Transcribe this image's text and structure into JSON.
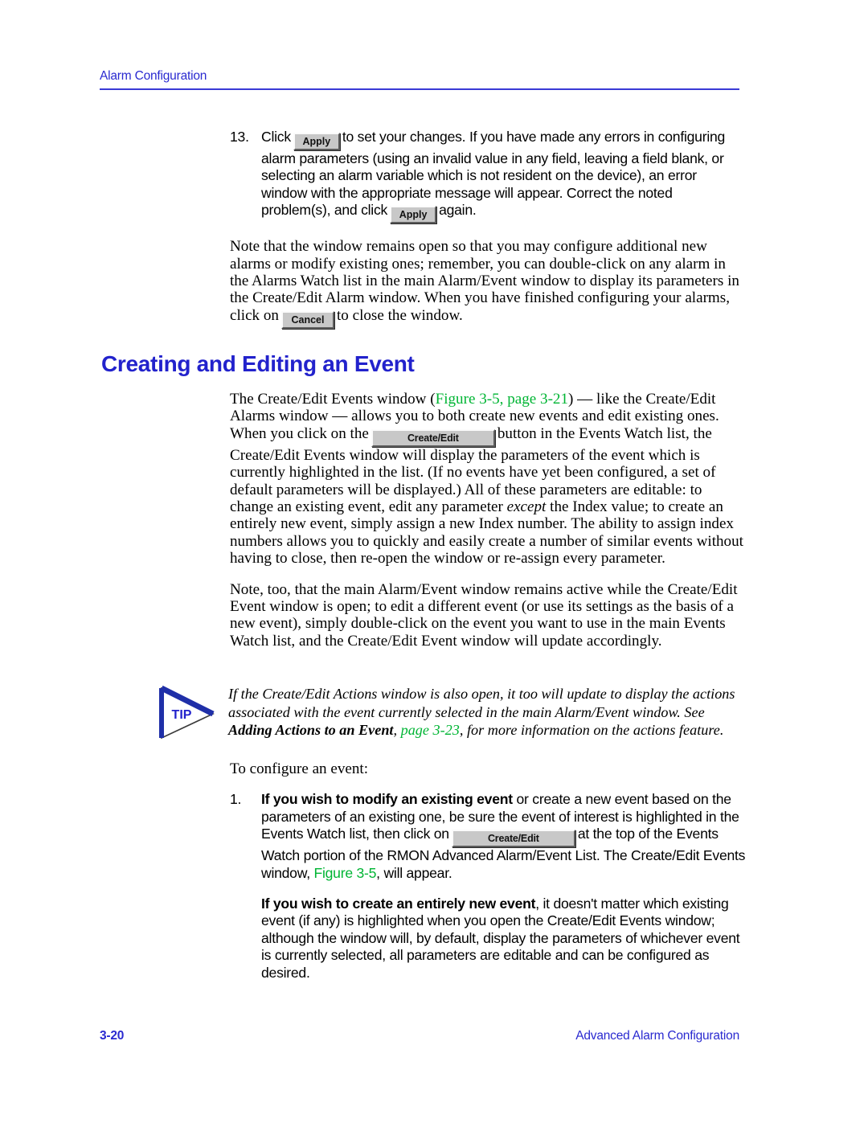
{
  "document": {
    "running_header": "Alarm Configuration",
    "footer_page_number": "3-20",
    "footer_title": "Advanced Alarm Configuration"
  },
  "colors": {
    "header_blue": "#2a2ad0",
    "rule_blue": "#3a3ad6",
    "heading_blue": "#2222cc",
    "xref_green": "#00b534",
    "button_face": "#c8c8c8",
    "text_black": "#000000"
  },
  "buttons": {
    "apply": "Apply",
    "cancel": "Cancel",
    "create_edit": "Create/Edit"
  },
  "step13": {
    "number": "13.",
    "t1": "Click",
    "t2": "to set your changes. If you have made any errors in configuring alarm parameters (using an invalid value in any field, leaving a field blank, or selecting an alarm variable which is not resident on the device), an error window with the appropriate message will appear. Correct the noted problem(s), and click",
    "t3": "again."
  },
  "note_paragraph": {
    "t1": "Note that the window remains open so that you may configure additional new alarms or modify existing ones; remember, you can double-click on any alarm in the Alarms Watch list in the main Alarm/Event window to display its parameters in the Create/Edit Alarm window. When you have finished configuring your alarms, click on",
    "t2": "to close the window."
  },
  "section": {
    "title": "Creating and Editing an Event"
  },
  "intro_paragraph": {
    "t1": "The Create/Edit Events window (",
    "xref1": "Figure 3-5",
    "t2": ", ",
    "xref2": "page 3-21",
    "t3": ") — like the Create/Edit Alarms window — allows you to both create new events and edit existing ones. When you click on the",
    "t4": "button in the Events Watch list, the Create/Edit Events window will display the parameters of the event which is currently highlighted in the list. (If no events have yet been configured, a set of default parameters will be displayed.) All of these parameters are editable: to change an existing event, edit any parameter",
    "em1": "except",
    "t5": "the Index value; to create an entirely new event, simply assign a new Index number. The ability to assign index numbers allows you to quickly and easily create a number of similar events without having to close, then re-open the window or re-assign every parameter."
  },
  "note_too_paragraph": {
    "text": "Note, too, that the main Alarm/Event window remains active while the Create/Edit Event window is open; to edit a different event (or use its settings as the basis of a new event), simply double-click on the event you want to use in the main Events Watch list, and the Create/Edit Event window will update accordingly."
  },
  "tip": {
    "label": "TIP",
    "t1": "If the Create/Edit Actions window is also open, it too will update to display the actions associated with the event currently selected in the main Alarm/Event window. See",
    "bold1": "Adding Actions to an Event",
    "t2": ", ",
    "xref1": "page 3-23",
    "t3": ", for more information on the actions feature."
  },
  "lead_in": {
    "text": "To configure an event:"
  },
  "step1": {
    "number": "1.",
    "bold1": "If you wish to modify an existing event",
    "t1": "or create a new event based on the parameters of an existing one, be sure the event of interest is highlighted in the Events Watch list, then click on",
    "t2": "at the top of the Events Watch portion of the RMON Advanced Alarm/Event List. The Create/Edit Events window,",
    "xref1": "Figure 3-5",
    "t3": ", will appear.",
    "bold2": "If you wish to create an entirely new event",
    "t4": ", it doesn't matter which existing event (if any) is highlighted when you open the Create/Edit Events window; although the window will, by default, display the parameters of whichever event is currently selected, all parameters are editable and can be configured as desired."
  }
}
